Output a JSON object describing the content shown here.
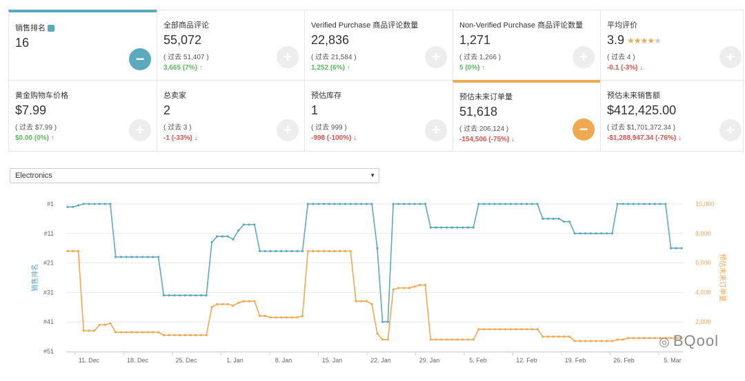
{
  "cards": {
    "sales_rank": {
      "title": "销售排名",
      "value": "16"
    },
    "total_reviews": {
      "title": "全部商品评论",
      "value": "55,072",
      "prev": "( 过去 51,407 )",
      "delta": "3,665 (7%)"
    },
    "verified_reviews": {
      "title": "Verified Purchase 商品评论数量",
      "value": "22,836",
      "prev": "( 过去 21,584 )",
      "delta": "1,252 (6%)"
    },
    "nonverified_reviews": {
      "title": "Non-Verified Purchase 商品评论数量",
      "value": "1,271",
      "prev": "( 过去 1,266 )",
      "delta": "5 (0%)"
    },
    "avg_rating": {
      "title": "平均评价",
      "value": "3.9",
      "prev": "( 过去 4 )",
      "delta": "-0.1 (-3%)",
      "stars": "★★★★",
      "stars_empty": "★"
    },
    "buybox_price": {
      "title": "黄金购物车价格",
      "value": "$7.99",
      "prev": "( 过去 $7.99 )",
      "delta": "$0.00 (0%)"
    },
    "total_sellers": {
      "title": "总卖家",
      "value": "2",
      "prev": "( 过去 3 )",
      "delta": "-1 (-33%)"
    },
    "est_inventory": {
      "title": "预估库存",
      "value": "1",
      "prev": "( 过去 999 )",
      "delta": "-998 (-100%)"
    },
    "est_orders": {
      "title": "预估未来订单量",
      "value": "51,618",
      "prev": "( 过去 206,124 )",
      "delta": "-154,506 (-75%)"
    },
    "est_sales": {
      "title": "预估未来销售额",
      "value": "$412,425.00",
      "prev": "( 过去 $1,701,372.34 )",
      "delta": "-$1,288,947.34 (-76%)"
    }
  },
  "symbols": {
    "plus": "+",
    "minus": "−",
    "up": "↑",
    "down": "↓",
    "select_arrow": "▼"
  },
  "category_select": {
    "value": "Electronics"
  },
  "watermark": {
    "text": "BQool",
    "icon": "wechat-icon"
  },
  "colors": {
    "blue": "#5aa9be",
    "orange": "#f0a851",
    "up": "#5cb85c",
    "down": "#d9534f"
  },
  "chart_data": {
    "type": "line",
    "xlabel": "",
    "x_ticks": [
      "11. Dec",
      "18. Dec",
      "25. Dec",
      "1. Jan",
      "8. Jan",
      "15. Jan",
      "22. Jan",
      "29. Jan",
      "5. Feb",
      "12. Feb",
      "19. Feb",
      "26. Feb",
      "5. Mar"
    ],
    "x_range": [
      0,
      93
    ],
    "y_left": {
      "label": "销售排名",
      "ticks": [
        "#1",
        "#11",
        "#21",
        "#31",
        "#41",
        "#51"
      ],
      "range": [
        1,
        51
      ],
      "reversed": true
    },
    "y_right": {
      "label": "预估未来订单量",
      "ticks": [
        "10,000",
        "8,000",
        "6,000",
        "4,000",
        "2,000"
      ],
      "range": [
        0,
        10000
      ]
    },
    "series": [
      {
        "name": "销售排名",
        "color": "#5aa9be",
        "axis": "left",
        "points": [
          [
            0,
            2
          ],
          [
            1,
            2
          ],
          [
            2,
            1.5
          ],
          [
            3,
            1
          ],
          [
            4,
            1
          ],
          [
            5,
            1
          ],
          [
            6,
            1
          ],
          [
            7,
            1
          ],
          [
            8,
            1
          ],
          [
            9,
            19
          ],
          [
            10,
            19
          ],
          [
            11,
            19
          ],
          [
            12,
            19
          ],
          [
            13,
            19
          ],
          [
            14,
            19
          ],
          [
            15,
            19
          ],
          [
            16,
            19
          ],
          [
            17,
            19
          ],
          [
            18,
            32
          ],
          [
            19,
            32
          ],
          [
            20,
            32
          ],
          [
            21,
            32
          ],
          [
            22,
            32
          ],
          [
            23,
            32
          ],
          [
            24,
            32
          ],
          [
            25,
            32
          ],
          [
            26,
            32
          ],
          [
            27,
            14
          ],
          [
            28,
            12
          ],
          [
            29,
            12
          ],
          [
            30,
            12
          ],
          [
            31,
            13
          ],
          [
            32,
            10
          ],
          [
            33,
            8
          ],
          [
            34,
            8
          ],
          [
            35,
            8
          ],
          [
            36,
            17
          ],
          [
            37,
            17
          ],
          [
            38,
            17
          ],
          [
            39,
            17
          ],
          [
            40,
            17
          ],
          [
            41,
            17
          ],
          [
            42,
            17
          ],
          [
            43,
            17
          ],
          [
            44,
            17
          ],
          [
            45,
            1
          ],
          [
            46,
            1
          ],
          [
            47,
            1
          ],
          [
            48,
            1
          ],
          [
            49,
            1
          ],
          [
            50,
            1
          ],
          [
            51,
            1
          ],
          [
            52,
            1
          ],
          [
            53,
            1
          ],
          [
            54,
            1
          ],
          [
            55,
            1
          ],
          [
            56,
            1
          ],
          [
            57,
            1
          ],
          [
            58,
            16
          ],
          [
            59,
            41
          ],
          [
            60,
            41
          ],
          [
            61,
            1
          ],
          [
            62,
            1
          ],
          [
            63,
            1
          ],
          [
            64,
            1
          ],
          [
            65,
            1
          ],
          [
            66,
            1
          ],
          [
            67,
            1
          ],
          [
            68,
            9
          ],
          [
            69,
            9
          ],
          [
            70,
            9
          ],
          [
            71,
            9
          ],
          [
            72,
            9
          ],
          [
            73,
            9
          ],
          [
            74,
            9
          ],
          [
            75,
            9
          ],
          [
            76,
            9
          ],
          [
            77,
            1
          ],
          [
            78,
            1
          ],
          [
            79,
            1
          ],
          [
            80,
            1
          ],
          [
            81,
            1
          ],
          [
            82,
            1
          ],
          [
            83,
            1
          ],
          [
            84,
            1
          ],
          [
            85,
            1
          ],
          [
            86,
            1
          ],
          [
            87,
            1
          ],
          [
            88,
            1
          ],
          [
            89,
            6
          ],
          [
            90,
            6
          ],
          [
            91,
            6
          ],
          [
            92,
            6
          ],
          [
            93,
            7
          ],
          [
            94,
            7
          ],
          [
            95,
            11
          ],
          [
            96,
            11
          ],
          [
            97,
            11
          ],
          [
            98,
            11
          ],
          [
            99,
            11
          ],
          [
            100,
            11
          ],
          [
            101,
            11
          ],
          [
            102,
            11
          ],
          [
            103,
            1
          ],
          [
            104,
            1
          ],
          [
            105,
            1
          ],
          [
            106,
            1
          ],
          [
            107,
            1
          ],
          [
            108,
            1
          ],
          [
            109,
            1
          ],
          [
            110,
            1
          ],
          [
            111,
            1
          ],
          [
            112,
            1
          ],
          [
            113,
            16
          ],
          [
            114,
            16
          ],
          [
            115,
            16
          ]
        ]
      },
      {
        "name": "预估未来订单量",
        "color": "#f0a851",
        "axis": "right",
        "points": [
          [
            0,
            6800
          ],
          [
            1,
            6800
          ],
          [
            2,
            6800
          ],
          [
            3,
            1400
          ],
          [
            4,
            1400
          ],
          [
            5,
            1400
          ],
          [
            6,
            1800
          ],
          [
            7,
            1800
          ],
          [
            8,
            1900
          ],
          [
            9,
            1300
          ],
          [
            10,
            1300
          ],
          [
            11,
            1300
          ],
          [
            12,
            1300
          ],
          [
            13,
            1300
          ],
          [
            14,
            1300
          ],
          [
            15,
            1300
          ],
          [
            16,
            1300
          ],
          [
            17,
            1300
          ],
          [
            18,
            1100
          ],
          [
            19,
            1100
          ],
          [
            20,
            1100
          ],
          [
            21,
            1100
          ],
          [
            22,
            1100
          ],
          [
            23,
            1100
          ],
          [
            24,
            1100
          ],
          [
            25,
            1100
          ],
          [
            26,
            1100
          ],
          [
            27,
            3000
          ],
          [
            28,
            3200
          ],
          [
            29,
            3200
          ],
          [
            30,
            3200
          ],
          [
            31,
            3100
          ],
          [
            32,
            3300
          ],
          [
            33,
            3400
          ],
          [
            34,
            3400
          ],
          [
            35,
            3400
          ],
          [
            36,
            2400
          ],
          [
            37,
            2400
          ],
          [
            38,
            2300
          ],
          [
            39,
            2300
          ],
          [
            40,
            2300
          ],
          [
            41,
            2300
          ],
          [
            42,
            2300
          ],
          [
            43,
            2300
          ],
          [
            44,
            2400
          ],
          [
            45,
            6800
          ],
          [
            46,
            6800
          ],
          [
            47,
            6800
          ],
          [
            48,
            6800
          ],
          [
            49,
            6800
          ],
          [
            50,
            6800
          ],
          [
            51,
            6800
          ],
          [
            52,
            6800
          ],
          [
            53,
            6800
          ],
          [
            54,
            3400
          ],
          [
            55,
            3400
          ],
          [
            56,
            3400
          ],
          [
            57,
            3200
          ],
          [
            58,
            1200
          ],
          [
            59,
            800
          ],
          [
            60,
            800
          ],
          [
            61,
            4200
          ],
          [
            62,
            4300
          ],
          [
            63,
            4300
          ],
          [
            64,
            4300
          ],
          [
            65,
            4400
          ],
          [
            66,
            4500
          ],
          [
            67,
            4500
          ],
          [
            68,
            800
          ],
          [
            69,
            800
          ],
          [
            70,
            800
          ],
          [
            71,
            800
          ],
          [
            72,
            800
          ],
          [
            73,
            800
          ],
          [
            74,
            800
          ],
          [
            75,
            800
          ],
          [
            76,
            800
          ],
          [
            77,
            1500
          ],
          [
            78,
            1500
          ],
          [
            79,
            1500
          ],
          [
            80,
            1500
          ],
          [
            81,
            1500
          ],
          [
            82,
            1500
          ],
          [
            83,
            1500
          ],
          [
            84,
            1500
          ],
          [
            85,
            1500
          ],
          [
            86,
            1500
          ],
          [
            87,
            1500
          ],
          [
            88,
            1500
          ],
          [
            89,
            1000
          ],
          [
            90,
            1000
          ],
          [
            91,
            1000
          ],
          [
            92,
            1000
          ],
          [
            93,
            1000
          ],
          [
            94,
            1000
          ],
          [
            95,
            700
          ],
          [
            96,
            700
          ],
          [
            97,
            700
          ],
          [
            98,
            700
          ],
          [
            99,
            700
          ],
          [
            100,
            700
          ],
          [
            101,
            700
          ],
          [
            102,
            700
          ],
          [
            103,
            800
          ],
          [
            104,
            800
          ],
          [
            105,
            900
          ],
          [
            106,
            900
          ],
          [
            107,
            900
          ],
          [
            108,
            900
          ],
          [
            109,
            900
          ],
          [
            110,
            900
          ],
          [
            111,
            900
          ],
          [
            112,
            900
          ],
          [
            113,
            900
          ],
          [
            114,
            900
          ],
          [
            115,
            900
          ]
        ]
      }
    ],
    "grid": true,
    "legend": "none"
  }
}
